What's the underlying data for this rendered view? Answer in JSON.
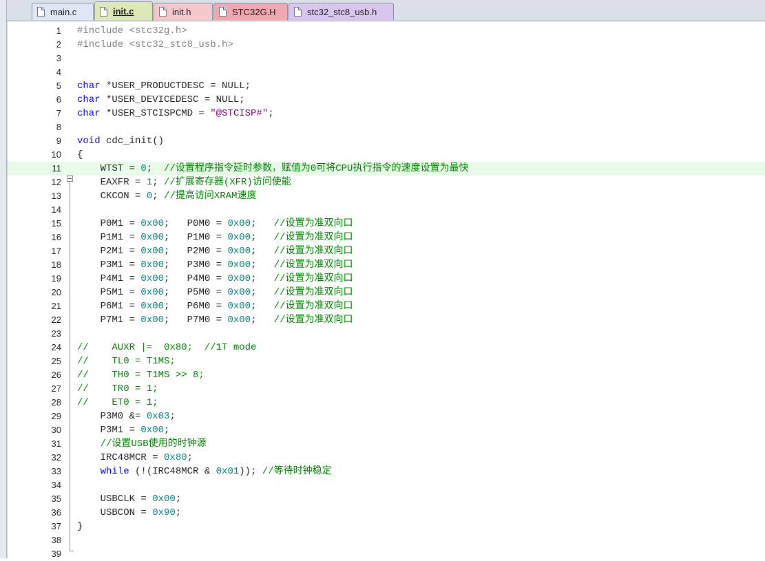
{
  "tabs": [
    {
      "label": "main.c",
      "color": "#dfe7f7",
      "active": false
    },
    {
      "label": "init.c",
      "color": "#dde8b8",
      "active": true
    },
    {
      "label": "init.h",
      "color": "#f5c8cd",
      "active": false
    },
    {
      "label": "STC32G.H",
      "color": "#f0a8b0",
      "active": false
    },
    {
      "label": "stc32_stc8_usb.h",
      "color": "#d8c6ef",
      "active": false
    }
  ],
  "editor": {
    "highlight_color": "#e8fbe8",
    "highlighted_line": 11,
    "fold_marker_line": 10,
    "lines": [
      {
        "n": "1",
        "text": "#include <stc32g.h>"
      },
      {
        "n": "2",
        "text": "#include <stc32_stc8_usb.h>"
      },
      {
        "n": "3",
        "text": ""
      },
      {
        "n": "4",
        "text": ""
      },
      {
        "n": "5",
        "text": "char *USER_PRODUCTDESC = NULL;"
      },
      {
        "n": "6",
        "text": "char *USER_DEVICEDESC = NULL;"
      },
      {
        "n": "7",
        "text": "char *USER_STCISPCMD = \"@STCISP#\";"
      },
      {
        "n": "8",
        "text": ""
      },
      {
        "n": "9",
        "text": "void cdc_init()"
      },
      {
        "n": "10",
        "text": "{"
      },
      {
        "n": "11",
        "text": "    WTST = 0;  //设置程序指令延时参数，赋值为0可将CPU执行指令的速度设置为最快"
      },
      {
        "n": "12",
        "text": "    EAXFR = 1; //扩展寄存器(XFR)访问使能"
      },
      {
        "n": "13",
        "text": "    CKCON = 0; //提高访问XRAM速度"
      },
      {
        "n": "14",
        "text": ""
      },
      {
        "n": "15",
        "text": "    P0M1 = 0x00;   P0M0 = 0x00;   //设置为准双向口"
      },
      {
        "n": "16",
        "text": "    P1M1 = 0x00;   P1M0 = 0x00;   //设置为准双向口"
      },
      {
        "n": "17",
        "text": "    P2M1 = 0x00;   P2M0 = 0x00;   //设置为准双向口"
      },
      {
        "n": "18",
        "text": "    P3M1 = 0x00;   P3M0 = 0x00;   //设置为准双向口"
      },
      {
        "n": "19",
        "text": "    P4M1 = 0x00;   P4M0 = 0x00;   //设置为准双向口"
      },
      {
        "n": "20",
        "text": "    P5M1 = 0x00;   P5M0 = 0x00;   //设置为准双向口"
      },
      {
        "n": "21",
        "text": "    P6M1 = 0x00;   P6M0 = 0x00;   //设置为准双向口"
      },
      {
        "n": "22",
        "text": "    P7M1 = 0x00;   P7M0 = 0x00;   //设置为准双向口"
      },
      {
        "n": "23",
        "text": ""
      },
      {
        "n": "24",
        "text": "//    AUXR |=  0x80;  //1T mode"
      },
      {
        "n": "25",
        "text": "//    TL0 = T1MS;"
      },
      {
        "n": "26",
        "text": "//    TH0 = T1MS >> 8;"
      },
      {
        "n": "27",
        "text": "//    TR0 = 1;"
      },
      {
        "n": "28",
        "text": "//    ET0 = 1;"
      },
      {
        "n": "29",
        "text": "    P3M0 &= 0x03;"
      },
      {
        "n": "30",
        "text": "    P3M1 = 0x00;"
      },
      {
        "n": "31",
        "text": "    //设置USB使用的时钟源"
      },
      {
        "n": "32",
        "text": "    IRC48MCR = 0x80;"
      },
      {
        "n": "33",
        "text": "    while (!(IRC48MCR & 0x01)); //等待时钟稳定"
      },
      {
        "n": "34",
        "text": ""
      },
      {
        "n": "35",
        "text": "    USBCLK = 0x00;"
      },
      {
        "n": "36",
        "text": "    USBCON = 0x90;"
      },
      {
        "n": "37",
        "text": "}"
      },
      {
        "n": "38",
        "text": ""
      },
      {
        "n": "39",
        "text": ""
      }
    ]
  }
}
